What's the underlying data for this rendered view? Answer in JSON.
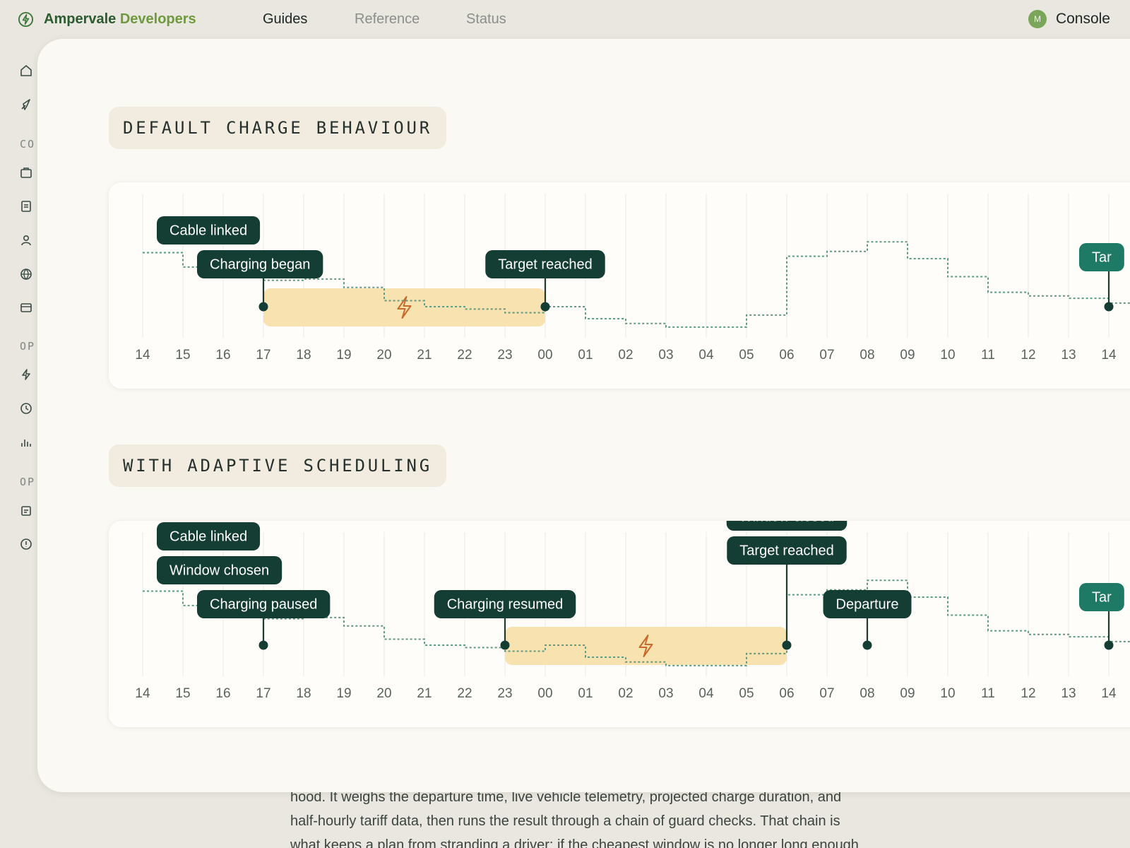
{
  "nav": {
    "brand_main": "Ampervale",
    "brand_sub": "Developers",
    "links": [
      {
        "label": "Guides",
        "active": true
      },
      {
        "label": "Reference",
        "active": false
      },
      {
        "label": "Status",
        "active": false
      }
    ],
    "console": {
      "avatar": "M",
      "label": "Console"
    }
  },
  "sidebar": {
    "groups": [
      {
        "label": "CO",
        "icons": [
          "briefcase-icon",
          "document-icon",
          "user-icon",
          "globe-icon",
          "card-icon"
        ]
      },
      {
        "label": "OP",
        "icons": [
          "bolt-icon",
          "clock-icon",
          "bar-chart-icon"
        ]
      },
      {
        "label": "OP",
        "icons": [
          "note-icon",
          "alert-circle-icon"
        ]
      }
    ],
    "top_icons": [
      "home-icon",
      "rocket-icon"
    ]
  },
  "sections": [
    {
      "title": "DEFAULT CHARGE BEHAVIOUR"
    },
    {
      "title": "WITH ADAPTIVE SCHEDULING"
    }
  ],
  "chart_data": [
    {
      "type": "line",
      "title": "DEFAULT CHARGE BEHAVIOUR",
      "x": [
        "14",
        "15",
        "16",
        "17",
        "18",
        "19",
        "20",
        "21",
        "22",
        "23",
        "00",
        "01",
        "02",
        "03",
        "04",
        "05",
        "06",
        "07",
        "08",
        "09",
        "10",
        "11",
        "12",
        "13",
        "14"
      ],
      "series": [
        {
          "values": [
            35,
            47,
            54,
            58,
            57,
            64,
            75,
            80,
            82,
            85,
            80,
            90,
            94,
            97,
            97,
            87,
            38,
            34,
            26,
            40,
            55,
            68,
            71,
            73,
            77
          ]
        }
      ],
      "charge_window": {
        "start": "17",
        "end": "00"
      },
      "events": [
        {
          "label": "Cable linked",
          "time": "16"
        },
        {
          "label": "Charging began",
          "time": "17"
        },
        {
          "label": "Target reached",
          "time": "00"
        },
        {
          "label": "Tar",
          "time": "14"
        }
      ],
      "grid": true
    },
    {
      "type": "line",
      "title": "WITH ADAPTIVE SCHEDULING",
      "x": [
        "14",
        "15",
        "16",
        "17",
        "18",
        "19",
        "20",
        "21",
        "22",
        "23",
        "00",
        "01",
        "02",
        "03",
        "04",
        "05",
        "06",
        "07",
        "08",
        "09",
        "10",
        "11",
        "12",
        "13",
        "14"
      ],
      "series": [
        {
          "values": [
            35,
            47,
            54,
            58,
            57,
            64,
            75,
            80,
            82,
            85,
            80,
            90,
            94,
            97,
            97,
            87,
            38,
            34,
            26,
            40,
            55,
            68,
            71,
            73,
            77
          ]
        }
      ],
      "charge_window": {
        "start": "23",
        "end": "06"
      },
      "events": [
        {
          "label": "Cable linked",
          "time": "16"
        },
        {
          "label": "Window chosen",
          "time": "16"
        },
        {
          "label": "Charging paused",
          "time": "17"
        },
        {
          "label": "Charging resumed",
          "time": "23"
        },
        {
          "label": "Window closed",
          "time": "06"
        },
        {
          "label": "Target reached",
          "time": "06"
        },
        {
          "label": "Departure",
          "time": "08"
        },
        {
          "label": "Tar",
          "time": "14"
        }
      ],
      "grid": true
    }
  ],
  "colors": {
    "pill": "#143d33",
    "pill_teal": "#1e7a64",
    "charge_band": "#f7e2b0",
    "bolt": "#c96a2a",
    "tariff_line": "#5f9a83",
    "gridline": "#ece9e1"
  },
  "body_text": {
    "lines": [
      "hood. It weighs the departure time, live vehicle telemetry, projected charge duration, and",
      "half-hourly tariff data, then runs the result through a chain of guard checks. That chain is",
      "what keeps a plan from stranding a driver: if the cheapest window is no longer long enough"
    ]
  }
}
